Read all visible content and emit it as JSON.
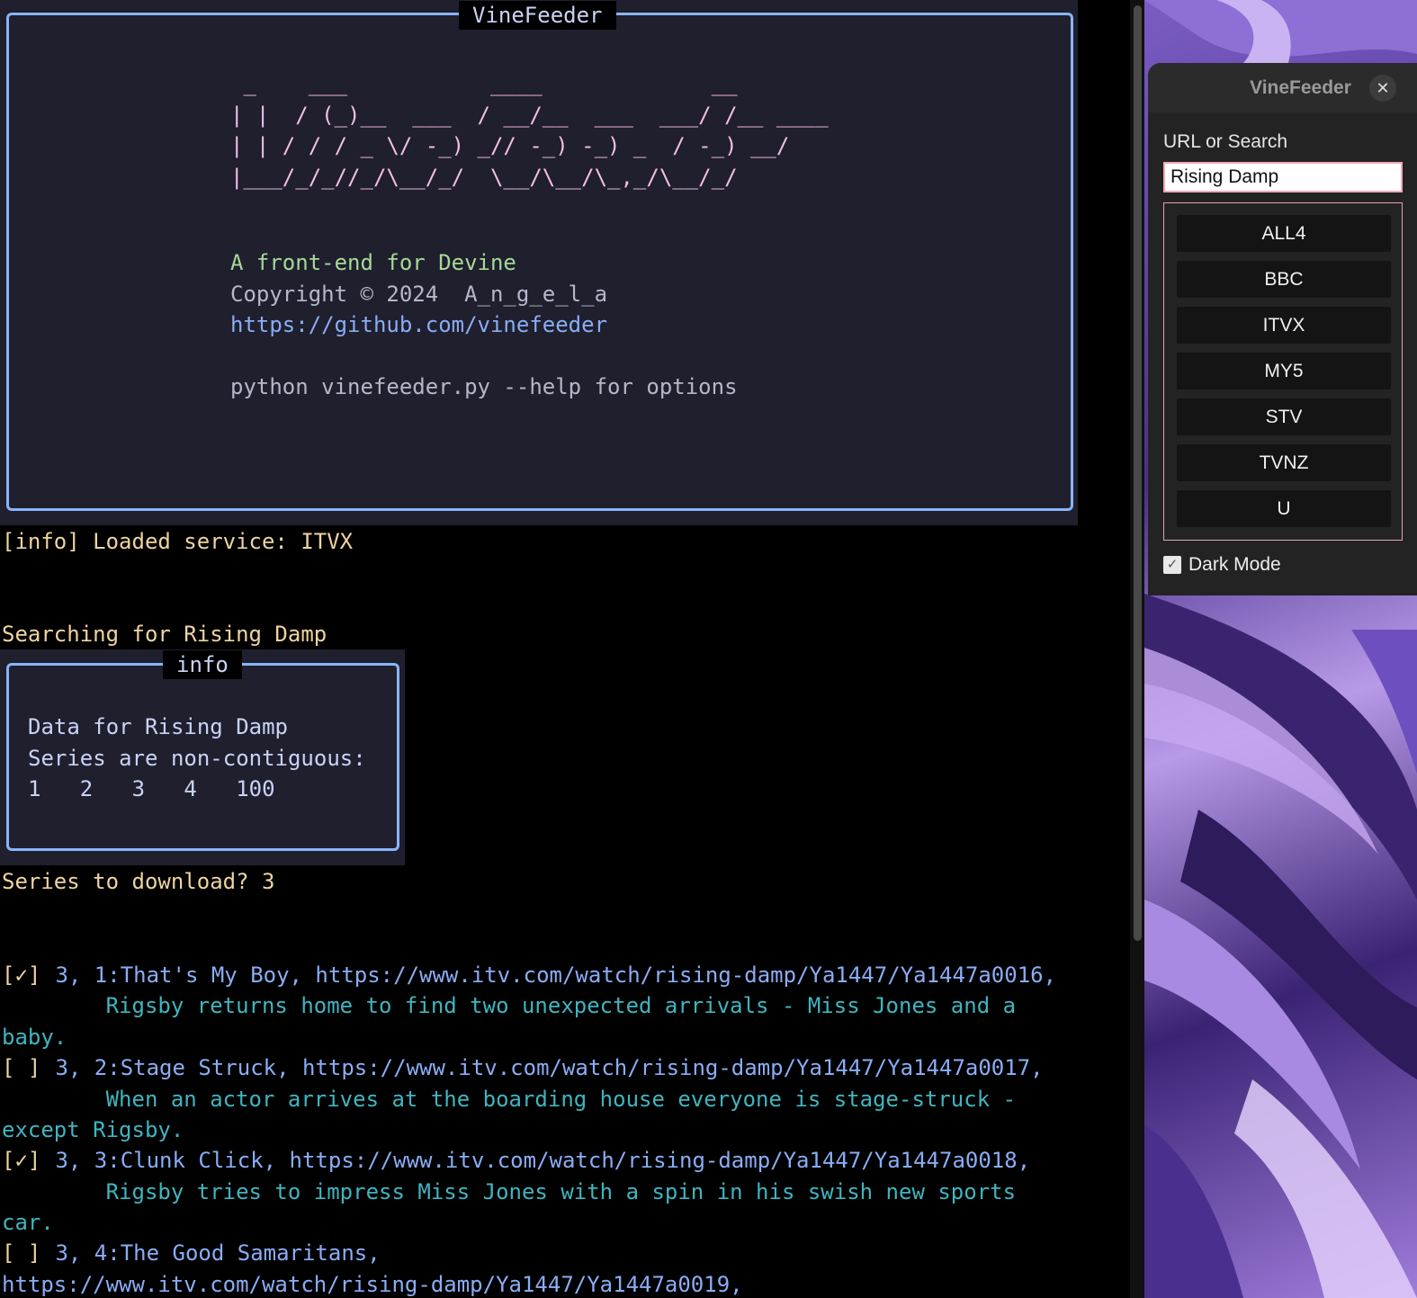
{
  "banner": {
    "title": "VineFeeder",
    "ascii_art": " _    ___           ____             __\n| |  / (_)__  ___  / __/__  ___  ___/ /__ ____\n| | / / / _ \\/ -_) _// -_) -_) _  / -_) __/\n|___/_/_//_/\\__/_/  \\__/\\__/\\_,_/\\__/_/",
    "tagline": "A front-end for Devine",
    "copyright": "Copyright © 2024  A_n_g_e_l_a",
    "url": "https://github.com/vinefeeder",
    "help": "python vinefeeder.py --help for options"
  },
  "log": {
    "loaded": "[info] Loaded service: ITVX",
    "searching": "Searching for Rising Damp",
    "prompt": "Series to download? 3"
  },
  "info_panel": {
    "title": "info",
    "line1": "Data for Rising Damp",
    "line2": "Series are non-contiguous:",
    "line3": "1   2   3   4   100"
  },
  "episodes": [
    {
      "mark": "[✓]",
      "ref": " 3, 1:That's My Boy, https://www.itv.com/watch/rising-damp/Ya1447/Ya1447a0016,",
      "desc_a": "        Rigsby returns home to find two unexpected arrivals - Miss Jones and a",
      "desc_b": "baby."
    },
    {
      "mark": "[ ]",
      "ref": " 3, 2:Stage Struck, https://www.itv.com/watch/rising-damp/Ya1447/Ya1447a0017,",
      "desc_a": "        When an actor arrives at the boarding house everyone is stage-struck -",
      "desc_b": "except Rigsby."
    },
    {
      "mark": "[✓]",
      "ref": " 3, 3:Clunk Click, https://www.itv.com/watch/rising-damp/Ya1447/Ya1447a0018,",
      "desc_a": "        Rigsby tries to impress Miss Jones with a spin in his swish new sports",
      "desc_b": "car."
    },
    {
      "mark": "[ ]",
      "ref": " 3, 4:The Good Samaritans,",
      "desc_a": "https://www.itv.com/watch/rising-damp/Ya1447/Ya1447a0019,",
      "desc_b": ""
    }
  ],
  "app": {
    "title": "VineFeeder",
    "close": "✕",
    "url_label": "URL or Search",
    "search_value": "Rising Damp",
    "services": [
      "ALL4",
      "BBC",
      "ITVX",
      "MY5",
      "STV",
      "TVNZ",
      "U"
    ],
    "dark_mode_label": "Dark Mode",
    "dark_mode_checked": true
  },
  "colors": {
    "panel_border": "#89b4fa",
    "ascii": "#f5bde6",
    "log_yellow": "#eed49f",
    "desc_teal": "#3fb5c0",
    "input_border": "#f2a9b8"
  }
}
